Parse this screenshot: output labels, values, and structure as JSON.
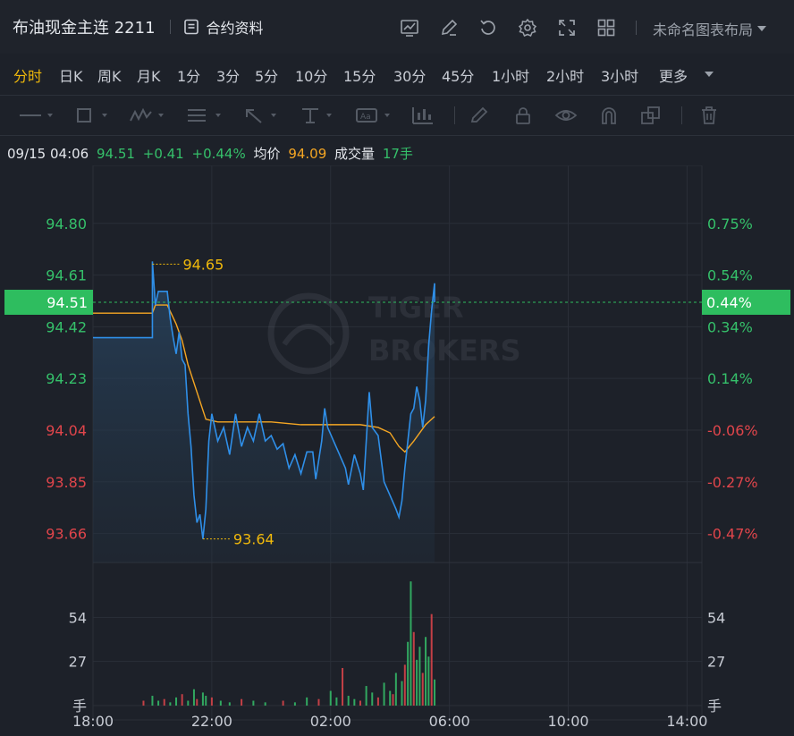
{
  "header": {
    "title": "布油现金主连 2211",
    "contract_info": "合约资料",
    "layout_name": "未命名图表布局"
  },
  "periods": [
    "分时",
    "日K",
    "周K",
    "月K",
    "1分",
    "3分",
    "5分",
    "10分",
    "15分",
    "30分",
    "45分",
    "1小时",
    "2小时",
    "3小时",
    "更多"
  ],
  "active_period": "分时",
  "info": {
    "time": "09/15 04:06",
    "price": "94.51",
    "change": "+0.41",
    "change_pct": "+0.44%",
    "avg_label": "均价",
    "avg_value": "94.09",
    "volume_label": "成交量",
    "volume_value": "17手"
  },
  "colors": {
    "up": "#35c06a",
    "down": "#e0454b",
    "price_line": "#2f8fe8",
    "avg_line": "#f5a623",
    "accent": "#f0b90b",
    "current_tag": "#2ebd5f"
  },
  "watermark": "TIGER BROKERS",
  "chart_data": {
    "type": "line",
    "x_ticks": [
      "18:00",
      "22:00",
      "02:00",
      "06:00",
      "10:00",
      "14:00"
    ],
    "y_ticks_price": [
      "94.80",
      "94.61",
      "94.42",
      "94.23",
      "94.04",
      "93.85",
      "93.66"
    ],
    "y_ticks_pct": [
      "0.75%",
      "0.54%",
      "0.34%",
      "0.14%",
      "-0.06%",
      "-0.27%",
      "-0.47%"
    ],
    "ylim": [
      93.56,
      94.98
    ],
    "xlim_hours": [
      0,
      20.5
    ],
    "prev_close": 94.1,
    "current_price": "94.51",
    "current_pct": "0.44%",
    "high_label": "94.65",
    "low_label": "93.64",
    "high": 94.65,
    "low": 93.64,
    "price_series": [
      [
        0.0,
        94.38
      ],
      [
        1.0,
        94.38
      ],
      [
        2.0,
        94.38
      ],
      [
        2.0,
        94.66
      ],
      [
        2.1,
        94.5
      ],
      [
        2.2,
        94.55
      ],
      [
        2.5,
        94.55
      ],
      [
        2.6,
        94.45
      ],
      [
        2.7,
        94.38
      ],
      [
        2.8,
        94.32
      ],
      [
        2.9,
        94.4
      ],
      [
        3.0,
        94.3
      ],
      [
        3.1,
        94.28
      ],
      [
        3.2,
        94.1
      ],
      [
        3.3,
        93.98
      ],
      [
        3.4,
        93.8
      ],
      [
        3.5,
        93.7
      ],
      [
        3.6,
        93.73
      ],
      [
        3.7,
        93.64
      ],
      [
        3.8,
        93.75
      ],
      [
        3.9,
        94.0
      ],
      [
        4.0,
        94.1
      ],
      [
        4.2,
        94.0
      ],
      [
        4.4,
        94.05
      ],
      [
        4.6,
        93.95
      ],
      [
        4.8,
        94.1
      ],
      [
        5.0,
        93.98
      ],
      [
        5.2,
        94.05
      ],
      [
        5.4,
        94.0
      ],
      [
        5.6,
        94.1
      ],
      [
        5.8,
        94.0
      ],
      [
        6.0,
        94.02
      ],
      [
        6.2,
        93.97
      ],
      [
        6.4,
        93.99
      ],
      [
        6.6,
        93.9
      ],
      [
        6.8,
        93.95
      ],
      [
        7.0,
        93.88
      ],
      [
        7.2,
        93.96
      ],
      [
        7.4,
        93.96
      ],
      [
        7.5,
        93.86
      ],
      [
        7.7,
        94.0
      ],
      [
        7.8,
        94.12
      ],
      [
        7.9,
        94.05
      ],
      [
        8.1,
        94.0
      ],
      [
        8.3,
        93.95
      ],
      [
        8.5,
        93.9
      ],
      [
        8.6,
        93.84
      ],
      [
        8.8,
        93.95
      ],
      [
        9.0,
        93.88
      ],
      [
        9.1,
        93.82
      ],
      [
        9.3,
        94.18
      ],
      [
        9.4,
        94.05
      ],
      [
        9.6,
        94.02
      ],
      [
        9.8,
        93.85
      ],
      [
        10.0,
        93.8
      ],
      [
        10.2,
        93.75
      ],
      [
        10.3,
        93.72
      ],
      [
        10.4,
        93.78
      ],
      [
        10.5,
        93.9
      ],
      [
        10.6,
        94.0
      ],
      [
        10.7,
        94.1
      ],
      [
        10.8,
        94.12
      ],
      [
        10.9,
        94.2
      ],
      [
        11.0,
        94.15
      ],
      [
        11.1,
        94.05
      ],
      [
        11.2,
        94.15
      ],
      [
        11.3,
        94.35
      ],
      [
        11.4,
        94.48
      ],
      [
        11.5,
        94.58
      ],
      [
        11.5,
        94.51
      ]
    ],
    "avg_series": [
      [
        0.0,
        94.47
      ],
      [
        1.0,
        94.47
      ],
      [
        2.0,
        94.47
      ],
      [
        2.1,
        94.5
      ],
      [
        2.5,
        94.5
      ],
      [
        2.8,
        94.43
      ],
      [
        3.0,
        94.37
      ],
      [
        3.2,
        94.28
      ],
      [
        3.5,
        94.18
      ],
      [
        3.8,
        94.08
      ],
      [
        4.2,
        94.07
      ],
      [
        5.0,
        94.07
      ],
      [
        6.0,
        94.07
      ],
      [
        7.0,
        94.06
      ],
      [
        8.0,
        94.06
      ],
      [
        9.0,
        94.06
      ],
      [
        9.6,
        94.05
      ],
      [
        10.0,
        94.03
      ],
      [
        10.3,
        93.98
      ],
      [
        10.5,
        93.96
      ],
      [
        10.8,
        94.0
      ],
      [
        11.2,
        94.06
      ],
      [
        11.5,
        94.09
      ]
    ],
    "volume_ticks": [
      "54",
      "27",
      "手"
    ],
    "volume_max": 81,
    "volume_bars": [
      [
        1.7,
        3
      ],
      [
        2.0,
        6
      ],
      [
        2.2,
        3
      ],
      [
        2.4,
        4
      ],
      [
        2.6,
        2
      ],
      [
        2.8,
        5
      ],
      [
        3.0,
        7
      ],
      [
        3.2,
        3
      ],
      [
        3.4,
        10
      ],
      [
        3.5,
        4
      ],
      [
        3.7,
        8
      ],
      [
        3.8,
        6
      ],
      [
        4.0,
        5
      ],
      [
        4.3,
        3
      ],
      [
        4.6,
        2
      ],
      [
        5.0,
        4
      ],
      [
        5.4,
        3
      ],
      [
        5.8,
        2
      ],
      [
        6.4,
        3
      ],
      [
        6.8,
        2
      ],
      [
        7.2,
        5
      ],
      [
        7.6,
        4
      ],
      [
        8.0,
        9
      ],
      [
        8.2,
        5
      ],
      [
        8.4,
        23
      ],
      [
        8.6,
        6
      ],
      [
        8.8,
        4
      ],
      [
        9.0,
        3
      ],
      [
        9.2,
        12
      ],
      [
        9.4,
        8
      ],
      [
        9.6,
        5
      ],
      [
        9.8,
        14
      ],
      [
        10.0,
        9
      ],
      [
        10.1,
        7
      ],
      [
        10.2,
        20
      ],
      [
        10.4,
        15
      ],
      [
        10.5,
        25
      ],
      [
        10.6,
        39
      ],
      [
        10.7,
        76
      ],
      [
        10.8,
        45
      ],
      [
        10.9,
        28
      ],
      [
        11.0,
        36
      ],
      [
        11.1,
        20
      ],
      [
        11.2,
        42
      ],
      [
        11.3,
        30
      ],
      [
        11.4,
        56
      ],
      [
        11.5,
        16
      ]
    ]
  }
}
